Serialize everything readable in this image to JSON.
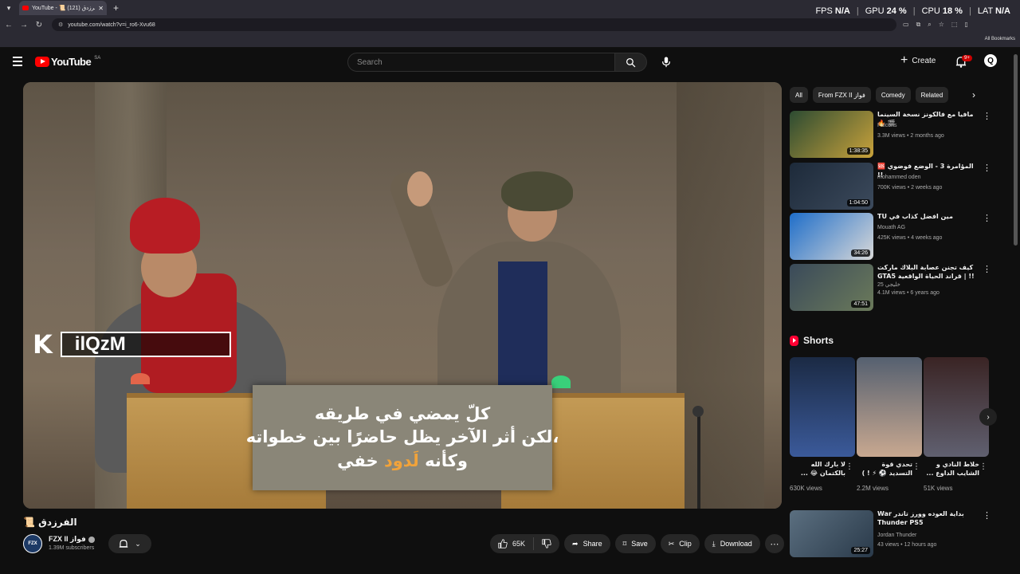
{
  "browser": {
    "tab_title": "YouTube - 📜 الفرزدق (121) 🔊",
    "tab_close": "✕",
    "new_tab": "+",
    "url": "youtube.com/watch?v=i_ro6-Xvu68",
    "all_bookmarks": "All Bookmarks"
  },
  "overlay": {
    "fps_label": "FPS",
    "fps_value": "N/A",
    "gpu_label": "GPU",
    "gpu_value": "24 %",
    "cpu_label": "CPU",
    "cpu_value": "18 %",
    "lat_label": "LAT",
    "lat_value": "N/A"
  },
  "header": {
    "logo_text": "YouTube",
    "country_code": "SA",
    "search_placeholder": "Search",
    "create_label": "Create",
    "notif_badge": "9+",
    "avatar_letter": "Q"
  },
  "video": {
    "caption_lines": [
      "كلّ يمضي في طريقه",
      "،لكن أثر الآخر يظل حاضرًا بين خطواته"
    ],
    "caption_line3_a": "وكأنه ",
    "caption_line3_hl": "لَدود",
    "caption_line3_b": " خفي",
    "watermark_letter": "K",
    "watermark_text": "ilQzM",
    "title": "الفرزدق 📜",
    "channel_name": "FZX II فواز",
    "channel_avatar": "FZX",
    "subscribers": "1.39M subscribers",
    "likes": "65K",
    "share_label": "Share",
    "save_label": "Save",
    "clip_label": "Clip",
    "download_label": "Download"
  },
  "sidebar": {
    "chips": [
      "All",
      "From FZX II فواز",
      "Comedy",
      "Related"
    ],
    "recommendations": [
      {
        "title": "مافيا مع فالكونز نسخة السينما 🎬 🔥",
        "channel": "Falcons",
        "meta": "3.3M views • 2 months ago",
        "duration": "1:38:35",
        "colors": [
          "#2c4b32",
          "#c9a23b"
        ]
      },
      {
        "title": "المؤامرة 3 - الوضع فوضوي 🆘 !!",
        "channel": "mohammed oden",
        "meta": "700K views • 2 weeks ago",
        "duration": "1:04:50",
        "colors": [
          "#1d2a3a",
          "#3c4a5c"
        ]
      },
      {
        "title": "مين افضل كذاب في TU",
        "channel": "Mouath AG",
        "meta": "425K views • 4 weeks ago",
        "duration": "34:26",
        "colors": [
          "#1f6ec9",
          "#d8d8d8"
        ]
      },
      {
        "title": "كيف تجنن عصابة البلاك ماركت !! | قراند الحياة الواقعية GTA5",
        "channel": "25 خليجي",
        "meta": "4.1M views • 6 years ago",
        "duration": "47:51",
        "colors": [
          "#3a4a5a",
          "#6b7a5a"
        ]
      }
    ],
    "shorts_heading": "Shorts",
    "shorts": [
      {
        "title": "لا بارك الله بالكتمان 😂 ...",
        "views": "630K views",
        "colors": [
          "#1b2a44",
          "#3b5a9a"
        ]
      },
      {
        "title": "تحدي قوة التسديد ⚽ ⚡ ! )",
        "views": "2.2M views",
        "colors": [
          "#556070",
          "#c8a890"
        ]
      },
      {
        "title": "خلاط النادي و الشايب الداوع ...",
        "views": "51K views",
        "colors": [
          "#3a2424",
          "#606070"
        ]
      }
    ],
    "bottom_rec": {
      "title": "بداية العوده وورز تاندر War Thunder PS5",
      "channel": "Jordan Thunder",
      "meta": "43 views • 12 hours ago",
      "duration": "25:27",
      "colors": [
        "#5b6f80",
        "#2a3a4a"
      ]
    }
  }
}
